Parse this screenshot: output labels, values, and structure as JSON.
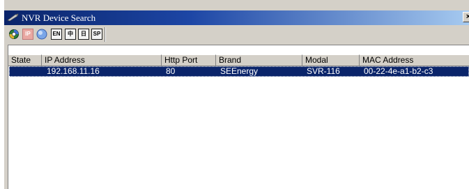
{
  "window": {
    "title": "NVR Device Search",
    "close_label": "×"
  },
  "toolbar": {
    "ip_label": "IP",
    "en_label": "EN",
    "zh_label": "中",
    "jp_label": "日",
    "sp_label": "SP"
  },
  "table": {
    "columns": [
      "State",
      "IP Address",
      "Http Port",
      "Brand",
      "Modal",
      "MAC Address"
    ],
    "rows": [
      {
        "state": "",
        "ip": "192.168.11.16",
        "port": "80",
        "brand": "SEEnergy",
        "modal": "SVR-116",
        "mac": "00-22-4e-a1-b2-c3"
      }
    ]
  },
  "colors": {
    "title_start": "#0a246a",
    "selection": "#0a246a",
    "face": "#d4d0c8"
  },
  "icons": [
    "app-icon",
    "gear-icon",
    "ip-icon",
    "help-icon",
    "close-icon"
  ]
}
